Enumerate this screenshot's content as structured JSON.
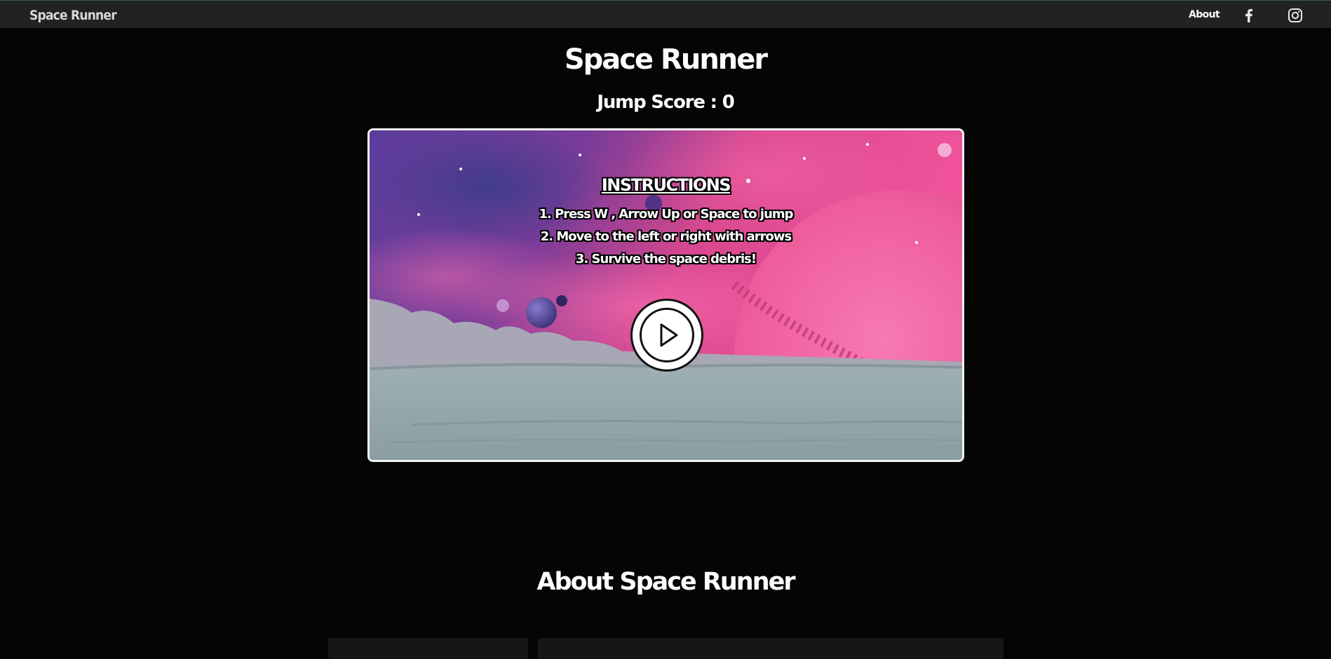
{
  "nav": {
    "brand": "Space Runner",
    "about_label": "About",
    "icons": [
      "facebook-icon",
      "instagram-icon"
    ]
  },
  "game": {
    "title": "Space Runner",
    "score_label": "Jump Score : ",
    "score_value": "0",
    "instructions": {
      "heading": "INSTRUCTIONS",
      "lines": [
        "1. Press W , Arrow Up or Space to jump",
        "2. Move to the left or right with arrows",
        "3. Survive the space debris!"
      ]
    },
    "play_icon": "play-icon"
  },
  "about": {
    "title": "About Space Runner"
  },
  "colors": {
    "navbar": "#222222",
    "page_bg": "#050505",
    "planet": "#f0609f",
    "ground": "#8fa3a6"
  }
}
